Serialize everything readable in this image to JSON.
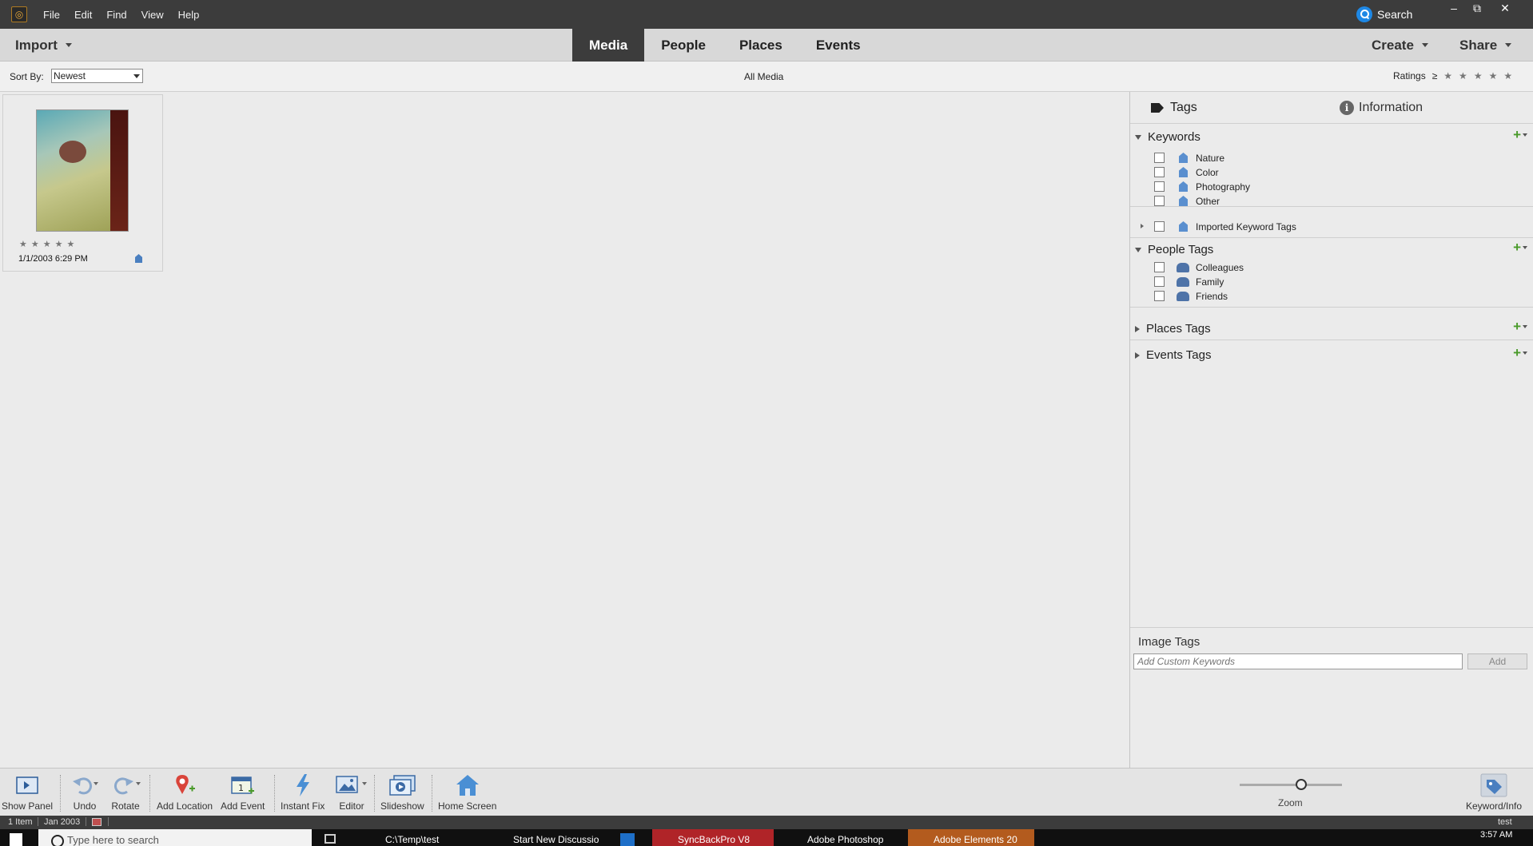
{
  "menu": [
    "File",
    "Edit",
    "Find",
    "View",
    "Help"
  ],
  "search_label": "Search",
  "window_controls": {
    "minimize": "–",
    "restore": "⧉",
    "close": "✕"
  },
  "import_label": "Import",
  "tabs": [
    {
      "label": "Media",
      "active": true
    },
    {
      "label": "People",
      "active": false
    },
    {
      "label": "Places",
      "active": false
    },
    {
      "label": "Events",
      "active": false
    }
  ],
  "create_label": "Create",
  "share_label": "Share",
  "sort": {
    "label": "Sort By:",
    "value": "Newest"
  },
  "view_title": "All Media",
  "ratings_label": "Ratings",
  "ratings_operator": "≥",
  "rating_stars": [
    "★",
    "★",
    "★",
    "★",
    "★"
  ],
  "media_items": [
    {
      "date": "1/1/2003 6:29 PM",
      "stars": [
        "★",
        "★",
        "★",
        "★",
        "★"
      ]
    }
  ],
  "panel": {
    "tab_tags": "Tags",
    "tab_info": "Information",
    "info_glyph": "i",
    "keywords": {
      "title": "Keywords",
      "items": [
        "Nature",
        "Color",
        "Photography",
        "Other",
        "Imported Keyword Tags"
      ]
    },
    "people": {
      "title": "People Tags",
      "items": [
        "Colleagues",
        "Family",
        "Friends"
      ]
    },
    "places_title": "Places Tags",
    "events_title": "Events Tags",
    "plus_glyph": "+",
    "image_tags_title": "Image Tags",
    "custom_keywords_placeholder": "Add Custom Keywords",
    "add_label": "Add"
  },
  "toolbar": {
    "show_panel": "Show Panel",
    "undo": "Undo",
    "rotate": "Rotate",
    "add_location": "Add Location",
    "add_event": "Add Event",
    "add_event_day": "1",
    "instant_fix": "Instant Fix",
    "editor": "Editor",
    "slideshow": "Slideshow",
    "home_screen": "Home Screen",
    "zoom": "Zoom",
    "zoom_level": 0.6,
    "keyword_info": "Keyword/Info"
  },
  "status": {
    "items": "1 Item",
    "date": "Jan 2003",
    "user": "test"
  },
  "taskbar": {
    "search_placeholder": "Type here to search",
    "items": [
      "C:\\Temp\\test",
      "Start New Discussio",
      "SyncBackPro V8",
      "Adobe Photoshop",
      "Adobe Elements 20"
    ],
    "clock": "3:57 AM"
  }
}
